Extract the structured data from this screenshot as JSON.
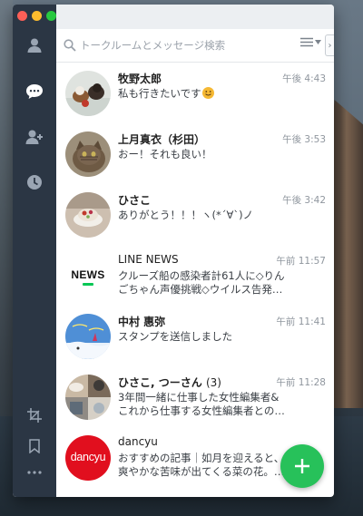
{
  "search": {
    "placeholder": "トークルームとメッセージ検索"
  },
  "sidebar": {
    "top_icons": [
      "friends-icon",
      "chats-icon",
      "add-friend-icon",
      "timeline-icon"
    ],
    "bottom_icons": [
      "crop-icon",
      "bookmark-icon",
      "more-icon"
    ]
  },
  "chats": [
    {
      "name": "牧野太郎",
      "time": "午後 4:43",
      "line1": "私も行きたいです",
      "line2": "",
      "emoji": "smile-emoji"
    },
    {
      "name": "上月真衣（杉田）",
      "time": "午後 3:53",
      "line1": "おー！それも良い！",
      "line2": ""
    },
    {
      "name": "ひさこ",
      "time": "午後 3:42",
      "line1": "ありがとう！！！ヽ(*´∀`)ノ",
      "line2": ""
    },
    {
      "name": "LINE NEWS",
      "time": "午前 11:57",
      "line1": "クルーズ船の感染者計61人に◇りん",
      "line2": "ごちゃん声優挑戦◇ウイルス告発…",
      "logo_text": "NEWS"
    },
    {
      "name": "中村 惠弥",
      "time": "午前 11:41",
      "line1": "スタンプを送信しました",
      "line2": ""
    },
    {
      "name": "ひさこ, つーさん",
      "member_count": "(3)",
      "time": "午前 11:28",
      "line1": "3年間一緒に仕事した女性編集者&",
      "line2": "これから仕事する女性編集者との…"
    },
    {
      "name": "dancyu",
      "time": "",
      "line1": "おすすめの記事｜如月を迎えると、",
      "line2": "爽やかな苦味が出てくる菜の花。…",
      "logo_text": "dancyu"
    }
  ],
  "colors": {
    "sidebar": "#2b3644",
    "fab": "#27c15a",
    "line_green": "#06c755"
  }
}
